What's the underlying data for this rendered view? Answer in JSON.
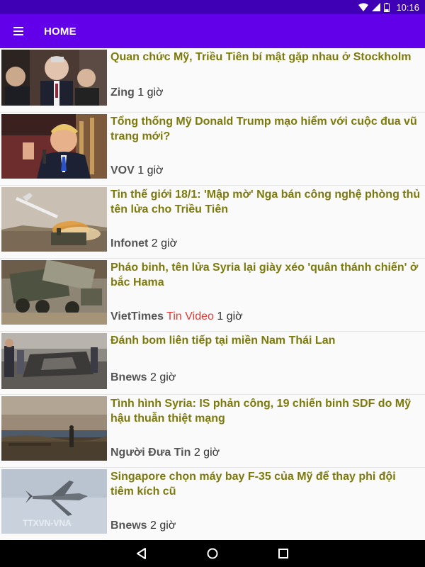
{
  "status": {
    "time": "10:16"
  },
  "appbar": {
    "title": "HOME"
  },
  "articles": [
    {
      "title": "Quan chức Mỹ, Triều Tiên bí mật gặp nhau ở Stockholm",
      "source": "Zing",
      "tag": "",
      "time": "1 giờ"
    },
    {
      "title": "Tổng thống Mỹ Donald Trump mạo hiểm với cuộc đua vũ trang mới?",
      "source": "VOV",
      "tag": "",
      "time": "1 giờ"
    },
    {
      "title": "Tin thế giới 18/1: 'Mập mờ' Nga bán công nghệ phòng thủ tên lửa cho Triều Tiên",
      "source": "Infonet",
      "tag": "",
      "time": "2 giờ"
    },
    {
      "title": "Pháo binh, tên lửa Syria lại giày xéo 'quân thánh chiến' ở bắc Hama",
      "source": "VietTimes",
      "tag": "Tin Video",
      "time": "1 giờ"
    },
    {
      "title": "Đánh bom liên tiếp tại miền Nam Thái Lan",
      "source": "Bnews",
      "tag": "",
      "time": "2 giờ"
    },
    {
      "title": "Tình hình Syria: IS phản công, 19 chiến binh SDF do Mỹ hậu thuẫn thiệt mạng",
      "source": "Người Đưa Tin",
      "tag": "",
      "time": "2 giờ"
    },
    {
      "title": "Singapore chọn máy bay F-35 của Mỹ để thay phi đội tiêm kích cũ",
      "source": "Bnews",
      "tag": "",
      "time": "2 giờ"
    }
  ],
  "watermark": "TTXVN-VNA",
  "colors": {
    "status_bar": "#3f00b5",
    "app_bar": "#6200ea",
    "title_text": "#7d7a0c",
    "tag_text": "#e53935"
  }
}
